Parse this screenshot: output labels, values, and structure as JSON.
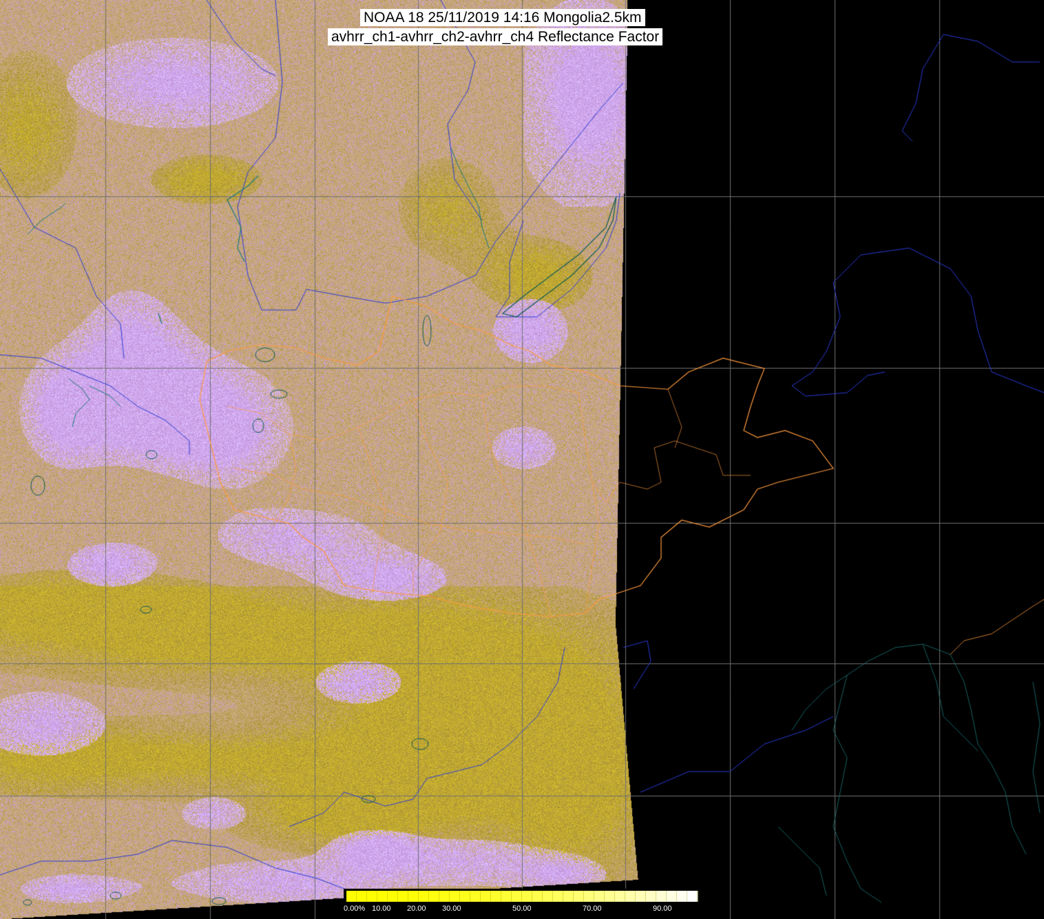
{
  "title": {
    "line1": "NOAA 18 25/11/2019 14:16 Mongolia2.5km",
    "line2": "avhrr_ch1-avhrr_ch2-avhrr_ch4 Reflectance Factor"
  },
  "colors": {
    "background": "#000000",
    "land_base": "#c7a77f",
    "cloud_lilac": "#c89be0",
    "cloud_bright": "#d9b8ff",
    "desert_olive": "#b39a3a",
    "desert_yellow": "#cdb62a",
    "graticule": "#707070",
    "border_blue": "#2a3bd6",
    "border_orange": "#ff9a3c",
    "coast_teal": "#1a7a7a",
    "lake_outline": "#0b5a52"
  },
  "legend": {
    "ticks": [
      "0.00%",
      "10.00",
      "20.00",
      "30.00",
      "50.00",
      "70.00",
      "90.00"
    ],
    "range": [
      0,
      100
    ]
  }
}
